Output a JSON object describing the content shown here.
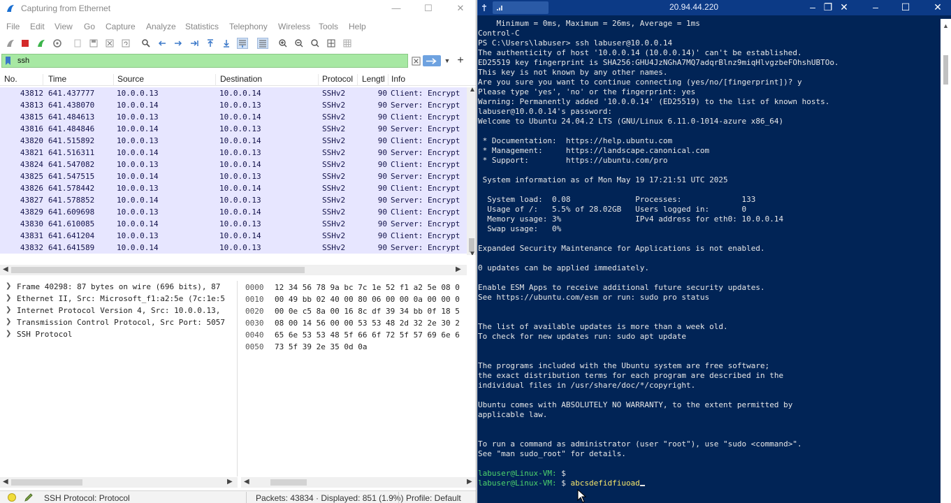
{
  "wireshark": {
    "title": "Capturing from Ethernet",
    "window_controls": [
      "—",
      "☐",
      "✕"
    ],
    "menu": [
      "File",
      "Edit",
      "View",
      "Go",
      "Capture",
      "Analyze",
      "Statistics",
      "Telephony",
      "Wireless",
      "Tools",
      "Help"
    ],
    "filter": {
      "value": "ssh"
    },
    "columns": [
      "No.",
      "Time",
      "Source",
      "Destination",
      "Protocol",
      "Lengtl",
      "Info"
    ],
    "packets": [
      {
        "no": "43812",
        "time": "641.437777",
        "src": "10.0.0.13",
        "dst": "10.0.0.14",
        "proto": "SSHv2",
        "len": "90",
        "info": "Client: Encrypt"
      },
      {
        "no": "43813",
        "time": "641.438070",
        "src": "10.0.0.14",
        "dst": "10.0.0.13",
        "proto": "SSHv2",
        "len": "90",
        "info": "Server: Encrypt"
      },
      {
        "no": "43815",
        "time": "641.484613",
        "src": "10.0.0.13",
        "dst": "10.0.0.14",
        "proto": "SSHv2",
        "len": "90",
        "info": "Client: Encrypt"
      },
      {
        "no": "43816",
        "time": "641.484846",
        "src": "10.0.0.14",
        "dst": "10.0.0.13",
        "proto": "SSHv2",
        "len": "90",
        "info": "Server: Encrypt"
      },
      {
        "no": "43820",
        "time": "641.515892",
        "src": "10.0.0.13",
        "dst": "10.0.0.14",
        "proto": "SSHv2",
        "len": "90",
        "info": "Client: Encrypt"
      },
      {
        "no": "43821",
        "time": "641.516311",
        "src": "10.0.0.14",
        "dst": "10.0.0.13",
        "proto": "SSHv2",
        "len": "90",
        "info": "Server: Encrypt"
      },
      {
        "no": "43824",
        "time": "641.547082",
        "src": "10.0.0.13",
        "dst": "10.0.0.14",
        "proto": "SSHv2",
        "len": "90",
        "info": "Client: Encrypt"
      },
      {
        "no": "43825",
        "time": "641.547515",
        "src": "10.0.0.14",
        "dst": "10.0.0.13",
        "proto": "SSHv2",
        "len": "90",
        "info": "Server: Encrypt"
      },
      {
        "no": "43826",
        "time": "641.578442",
        "src": "10.0.0.13",
        "dst": "10.0.0.14",
        "proto": "SSHv2",
        "len": "90",
        "info": "Client: Encrypt"
      },
      {
        "no": "43827",
        "time": "641.578852",
        "src": "10.0.0.14",
        "dst": "10.0.0.13",
        "proto": "SSHv2",
        "len": "90",
        "info": "Server: Encrypt"
      },
      {
        "no": "43829",
        "time": "641.609698",
        "src": "10.0.0.13",
        "dst": "10.0.0.14",
        "proto": "SSHv2",
        "len": "90",
        "info": "Client: Encrypt"
      },
      {
        "no": "43830",
        "time": "641.610085",
        "src": "10.0.0.14",
        "dst": "10.0.0.13",
        "proto": "SSHv2",
        "len": "90",
        "info": "Server: Encrypt"
      },
      {
        "no": "43831",
        "time": "641.641204",
        "src": "10.0.0.13",
        "dst": "10.0.0.14",
        "proto": "SSHv2",
        "len": "90",
        "info": "Client: Encrypt"
      },
      {
        "no": "43832",
        "time": "641.641589",
        "src": "10.0.0.14",
        "dst": "10.0.0.13",
        "proto": "SSHv2",
        "len": "90",
        "info": "Server: Encrypt"
      }
    ],
    "details": [
      "Frame 40298: 87 bytes on wire (696 bits), 87",
      "Ethernet II, Src: Microsoft_f1:a2:5e (7c:1e:5",
      "Internet Protocol Version 4, Src: 10.0.0.13,",
      "Transmission Control Protocol, Src Port: 5057",
      "SSH Protocol"
    ],
    "bytes": [
      {
        "offset": "0000",
        "hex": "12 34 56 78 9a bc 7c 1e  52 f1 a2 5e 08 0"
      },
      {
        "offset": "0010",
        "hex": "00 49 bb 02 40 00 80 06  00 00 0a 00 00 0"
      },
      {
        "offset": "0020",
        "hex": "00 0e c5 8a 00 16 8c df  39 34 bb 0f 18 5"
      },
      {
        "offset": "0030",
        "hex": "08 00 14 56 00 00 53 53  48 2d 32 2e 30 2"
      },
      {
        "offset": "0040",
        "hex": "65 6e 53 53 48 5f 66 6f  72 5f 57 69 6e 6"
      },
      {
        "offset": "0050",
        "hex": "73 5f 39 2e 35 0d 0a"
      }
    ],
    "status": {
      "protocol": "SSH Protocol: Protocol",
      "packets": "Packets: 43834 · Displayed: 851 (1.9%)",
      "profile": "Profile: Default"
    },
    "colors": {
      "row_bg": "#e7e6ff",
      "filter_bg": "#a7e8a3"
    }
  },
  "terminal": {
    "remote_ip": "20.94.44.220",
    "colors": {
      "background": "#012456",
      "prompt": "#4dd26b",
      "command": "#f7e56a"
    },
    "lines": [
      "    Minimum = 0ms, Maximum = 26ms, Average = 1ms",
      "Control-C",
      "PS C:\\Users\\labuser> ssh labuser@10.0.0.14",
      "The authenticity of host '10.0.0.14 (10.0.0.14)' can't be established.",
      "ED25519 key fingerprint is SHA256:GHU4JzNGhA7MQ7adqrBlnz9miqHlvgzbeFOhshUBTOo.",
      "This key is not known by any other names.",
      "Are you sure you want to continue connecting (yes/no/[fingerprint])? y",
      "Please type 'yes', 'no' or the fingerprint: yes",
      "Warning: Permanently added '10.0.0.14' (ED25519) to the list of known hosts.",
      "labuser@10.0.0.14's password:",
      "Welcome to Ubuntu 24.04.2 LTS (GNU/Linux 6.11.0-1014-azure x86_64)",
      "",
      " * Documentation:  https://help.ubuntu.com",
      " * Management:     https://landscape.canonical.com",
      " * Support:        https://ubuntu.com/pro",
      "",
      " System information as of Mon May 19 17:21:51 UTC 2025",
      "",
      "  System load:  0.08              Processes:             133",
      "  Usage of /:   5.5% of 28.02GB   Users logged in:       0",
      "  Memory usage: 3%                IPv4 address for eth0: 10.0.0.14",
      "  Swap usage:   0%",
      "",
      "Expanded Security Maintenance for Applications is not enabled.",
      "",
      "0 updates can be applied immediately.",
      "",
      "Enable ESM Apps to receive additional future security updates.",
      "See https://ubuntu.com/esm or run: sudo pro status",
      "",
      "",
      "The list of available updates is more than a week old.",
      "To check for new updates run: sudo apt update",
      "",
      "",
      "The programs included with the Ubuntu system are free software;",
      "the exact distribution terms for each program are described in the",
      "individual files in /usr/share/doc/*/copyright.",
      "",
      "Ubuntu comes with ABSOLUTELY NO WARRANTY, to the extent permitted by",
      "applicable law.",
      "",
      "",
      "To run a command as administrator (user \"root\"), use \"sudo <command>\".",
      "See \"man sudo_root\" for details.",
      ""
    ],
    "prompt": "labuser@Linux-VM:",
    "prompt_suffix": " $ ",
    "last_command": "abcsdefidfiuoad"
  }
}
